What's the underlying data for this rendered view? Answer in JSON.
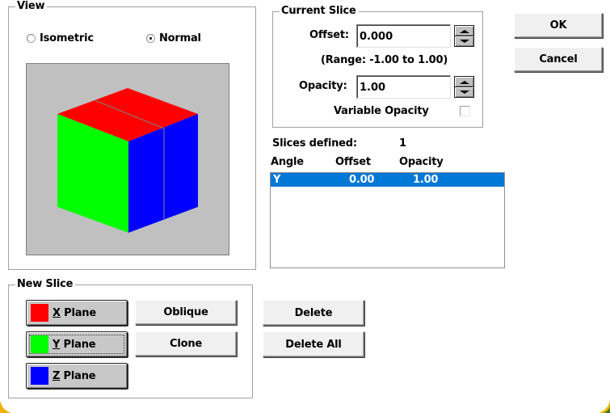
{
  "view": {
    "title": "View",
    "options": [
      {
        "label": "Isometric",
        "selected": false
      },
      {
        "label": "Normal",
        "selected": true
      }
    ],
    "preview": {
      "background": "#c0c0c0",
      "top_face_color": "#ff0000",
      "left_face_color": "#00ff00",
      "right_face_color": "#0000ff",
      "slice_line_color": "#808080"
    }
  },
  "current_slice": {
    "title": "Current Slice",
    "offset_label": "Offset:",
    "offset_value": "0.000",
    "range_text": "(Range: -1.00 to 1.00)",
    "opacity_label": "Opacity:",
    "opacity_value": "1.00",
    "variable_opacity_label": "Variable Opacity",
    "variable_opacity_checked": false
  },
  "dialog_buttons": {
    "ok": "OK",
    "cancel": "Cancel"
  },
  "slices": {
    "defined_label": "Slices defined:",
    "defined_count": "1",
    "columns": [
      "Angle",
      "Offset",
      "Opacity"
    ],
    "rows": [
      {
        "angle": "Y",
        "offset": "0.00",
        "opacity": "1.00",
        "selected": true
      }
    ],
    "selection_color": "#0078d7"
  },
  "new_slice": {
    "title": "New Slice",
    "planes": [
      {
        "mnemonic": "X",
        "rest": " Plane",
        "color": "#ff0000",
        "focused": false
      },
      {
        "mnemonic": "Y",
        "rest": " Plane",
        "color": "#00ff00",
        "focused": true
      },
      {
        "mnemonic": "Z",
        "rest": " Plane",
        "color": "#0000ff",
        "focused": false
      }
    ],
    "oblique": "Oblique",
    "clone": "Clone"
  },
  "list_actions": {
    "delete": "Delete",
    "delete_all": "Delete All"
  }
}
